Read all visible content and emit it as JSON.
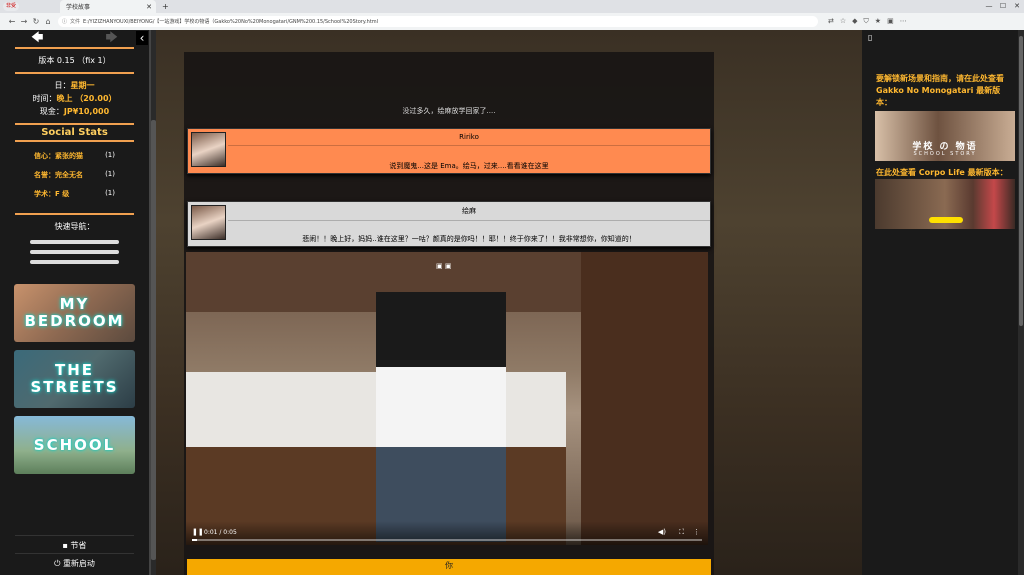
{
  "browser": {
    "profile": "非受",
    "tab_title": "学校故事",
    "url_warn": "文件",
    "url": "E:/YIZIZHANYOUXI/BEIYONG/【一站游戏】学校の物语（Gakko%20No%20Monogatari/GNM%200.15/School%20Story.html"
  },
  "left": {
    "version": "版本 0.15 （fix 1）",
    "day_label": "日：",
    "day": "星期一",
    "time_label": "时间：",
    "time": "晚上 （20.00）",
    "cash_label": "现金：",
    "cash": "JP¥10,000",
    "social_title": "Social Stats",
    "stats": [
      {
        "name": "信心：",
        "value": "紧张的猫",
        "num": "(1)"
      },
      {
        "name": "名誉：",
        "value": "完全无名",
        "num": "(1)"
      },
      {
        "name": "学术：",
        "value": "F 级",
        "num": "(1)"
      }
    ],
    "quick_nav": "快速导航：",
    "locations": [
      "MY BEDROOM",
      "THE STREETS",
      "SCHOOL"
    ],
    "save": "节省",
    "restart": "重新启动"
  },
  "main": {
    "narration": "没过多久，绘麻放学回家了....",
    "dialogs": [
      {
        "name": "Ririko",
        "text": "说到魔鬼...这是 Ema。绘马，过来....看看谁在这里",
        "color": "#ff8a50"
      },
      {
        "name": "绘麻",
        "text": "悲闹！！晚上好，妈妈..谁在这里？一咕？颜真的是你吗！！耶！！终于你来了！！我非常想你，你知道的！",
        "color": "#d9d9d9"
      }
    ],
    "video_time": "0:01 / 0:05",
    "you_label": "你"
  },
  "right": {
    "promo1": "要解锁新场景和指南，请在此处查看 Gakko No Monogatari 最新版本：",
    "promo1_logo": "学校 の 物语",
    "promo1_sub": "SCHOOL STORY",
    "promo2": "在此处查看 Corpo Life 最新版本："
  }
}
